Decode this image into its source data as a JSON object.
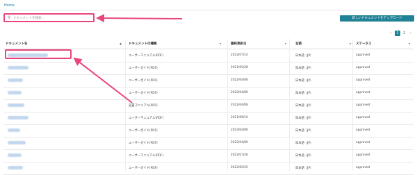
{
  "breadcrumb": {
    "home": "Home"
  },
  "search": {
    "icon": "search-icon",
    "placeholder": "ドキュメントを検索..."
  },
  "toolbar": {
    "upload_label": "新しいドキュメントをアップロード"
  },
  "pagination": {
    "prev": "‹",
    "pages": [
      "1",
      "2"
    ],
    "current": "1",
    "next": "›"
  },
  "table": {
    "columns": [
      "ドキュメント名",
      "ドキュメントの種類",
      "最終更新日",
      "言語",
      "ステータス"
    ],
    "rows": [
      {
        "name_width": 58,
        "type": "ユーザーマニュアル(PDF)",
        "date": "2022/07/14",
        "lang": "日本語（JP）",
        "status": "approved"
      },
      {
        "name_width": 30,
        "type": "ユーザーガイド(PDF)",
        "date": "2021/05/28",
        "lang": "日本語（JP）",
        "status": "approved"
      },
      {
        "name_width": 22,
        "type": "ユーザーガイド(PDF)",
        "date": "2022/04/06",
        "lang": "日本語（JP）",
        "status": "approved"
      },
      {
        "name_width": 20,
        "type": "ユーザーガイド(PDF)",
        "date": "2022/04/06",
        "lang": "日本語（JP）",
        "status": "approved"
      },
      {
        "name_width": 24,
        "type": "設置マニュアル(PDF)",
        "date": "2022/04/06",
        "lang": "日本語（JP）",
        "status": "approved"
      },
      {
        "name_width": 30,
        "type": "ユーザーマニュアル(PDF)",
        "date": "2021/09/10",
        "lang": "日本語（JP）",
        "status": "approved"
      },
      {
        "name_width": 18,
        "type": "ユーザーガイド(PDF)",
        "date": "2022/04/06",
        "lang": "日本語（JP）",
        "status": "approved"
      },
      {
        "name_width": 26,
        "type": "ユーザーガイド(PDF)",
        "date": "2022/04/06",
        "lang": "日本語（JP）",
        "status": "approved"
      },
      {
        "name_width": 20,
        "type": "ユーザーマニュアル(PDF)",
        "date": "2022/07/26",
        "lang": "日本語（JP）",
        "status": "approved"
      },
      {
        "name_width": 22,
        "type": "ユーザーガイド(PDF)",
        "date": "2022/05/25",
        "lang": "日本語（JP）",
        "status": "approved"
      }
    ]
  },
  "annotation": {
    "color": "#e8467c"
  }
}
